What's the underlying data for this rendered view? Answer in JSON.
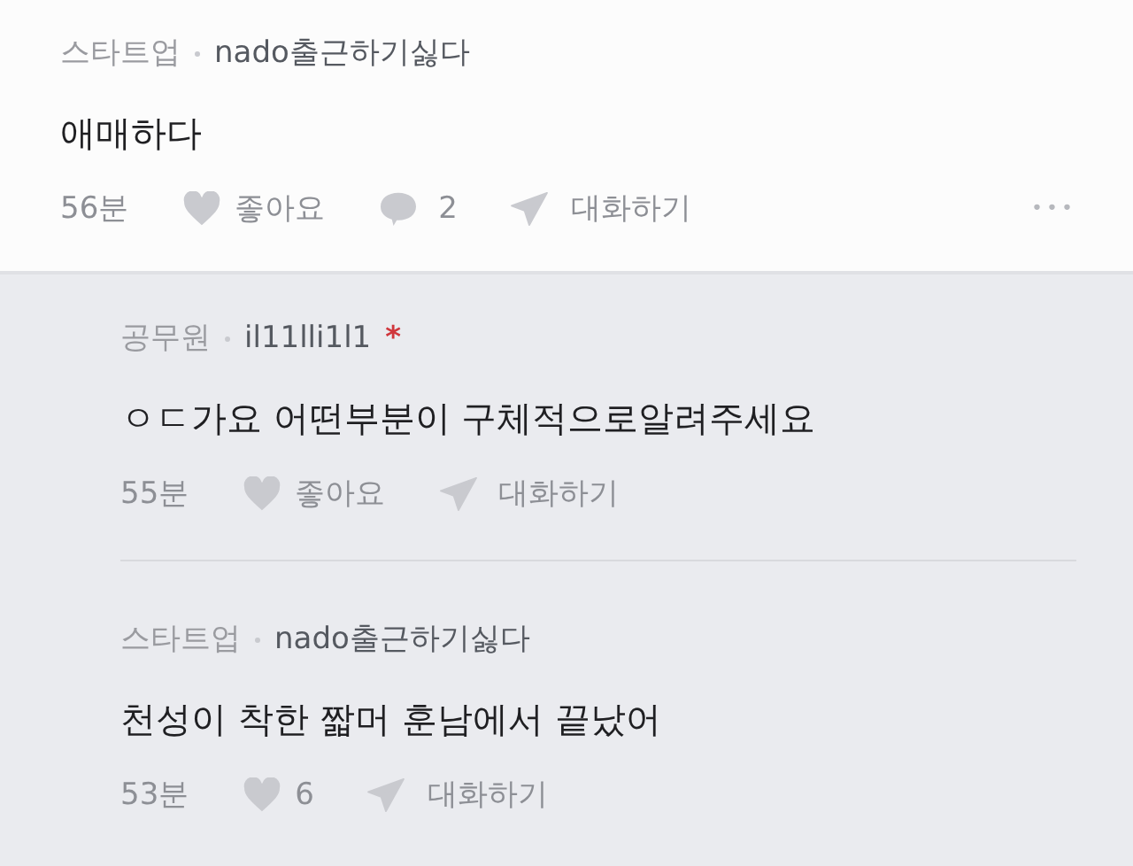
{
  "comment": {
    "category": "스타트업",
    "author": "nado출근하기싫다",
    "body": "애매하다",
    "time": "56분",
    "like_label": "좋아요",
    "comment_count": "2",
    "reply_label": "대화하기",
    "more": "•••"
  },
  "replies": [
    {
      "category": "공무원",
      "author": "il11lli1l1",
      "badge": "*",
      "body": "ㅇㄷ가요 어떤부분이 구체적으로알려주세요",
      "time": "55분",
      "like_label": "좋아요",
      "reply_label": "대화하기"
    },
    {
      "category": "스타트업",
      "author": "nado출근하기싫다",
      "body": "천성이 착한 짧머 훈남에서 끝났어",
      "time": "53분",
      "like_label": "6",
      "reply_label": "대화하기"
    }
  ]
}
